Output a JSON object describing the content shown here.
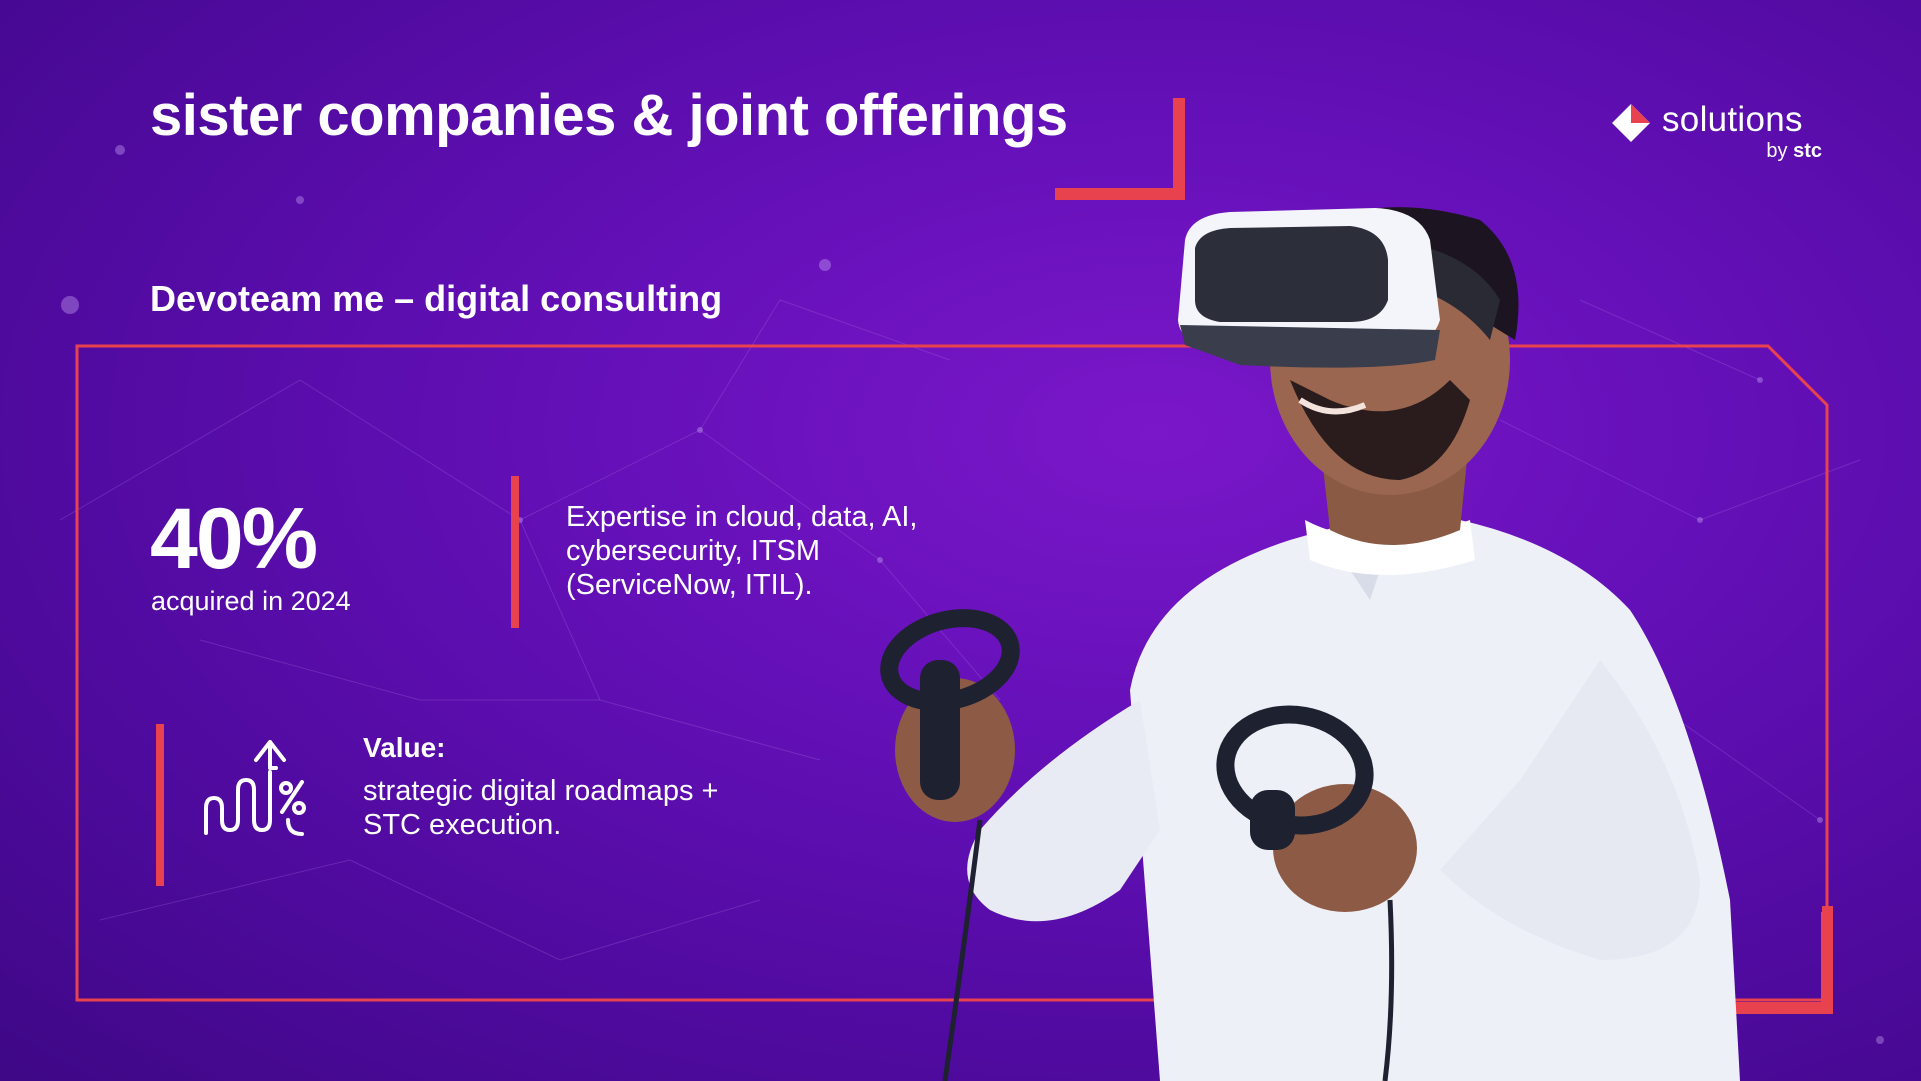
{
  "slide": {
    "title": "sister companies & joint offerings",
    "subtitle": "Devoteam me – digital consulting"
  },
  "logo": {
    "name": "solutions",
    "by": "by",
    "brand": "stc"
  },
  "stat": {
    "value": "40%",
    "caption": "acquired in 2024"
  },
  "expertise": {
    "text": "Expertise in cloud, data, AI, cybersecurity, ITSM (ServiceNow, ITIL)."
  },
  "value": {
    "label": "Value:",
    "text": "strategic digital roadmaps + STC execution.",
    "icon": "growth-percent-icon"
  },
  "colors": {
    "background": "#5a0fae",
    "accent": "#e9424f",
    "text": "#ffffff"
  }
}
